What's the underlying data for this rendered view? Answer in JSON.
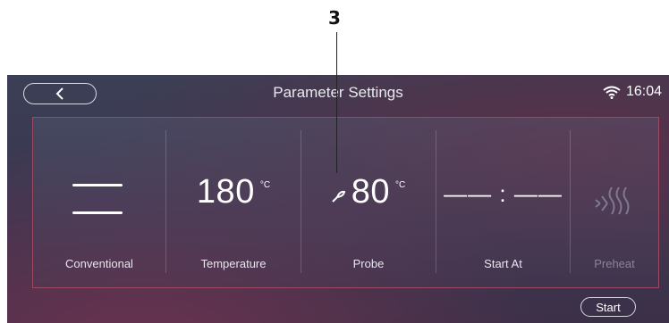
{
  "annotation": {
    "number": "3"
  },
  "header": {
    "title": "Parameter Settings",
    "time": "16:04"
  },
  "params": [
    {
      "label": "Conventional",
      "icon": "conventional-mode-icon"
    },
    {
      "label": "Temperature",
      "value": "180",
      "unit": "°C"
    },
    {
      "label": "Probe",
      "value": "80",
      "unit": "°C",
      "icon": "probe-icon"
    },
    {
      "label": "Start At",
      "value": "—— : ——"
    },
    {
      "label": "Preheat",
      "icon": "preheat-icon",
      "state": "disabled"
    }
  ],
  "footer": {
    "start_label": "Start"
  },
  "colors": {
    "panel_border": "#9c4a62",
    "text": "#ffffff",
    "disabled_text": "#8a8497"
  }
}
